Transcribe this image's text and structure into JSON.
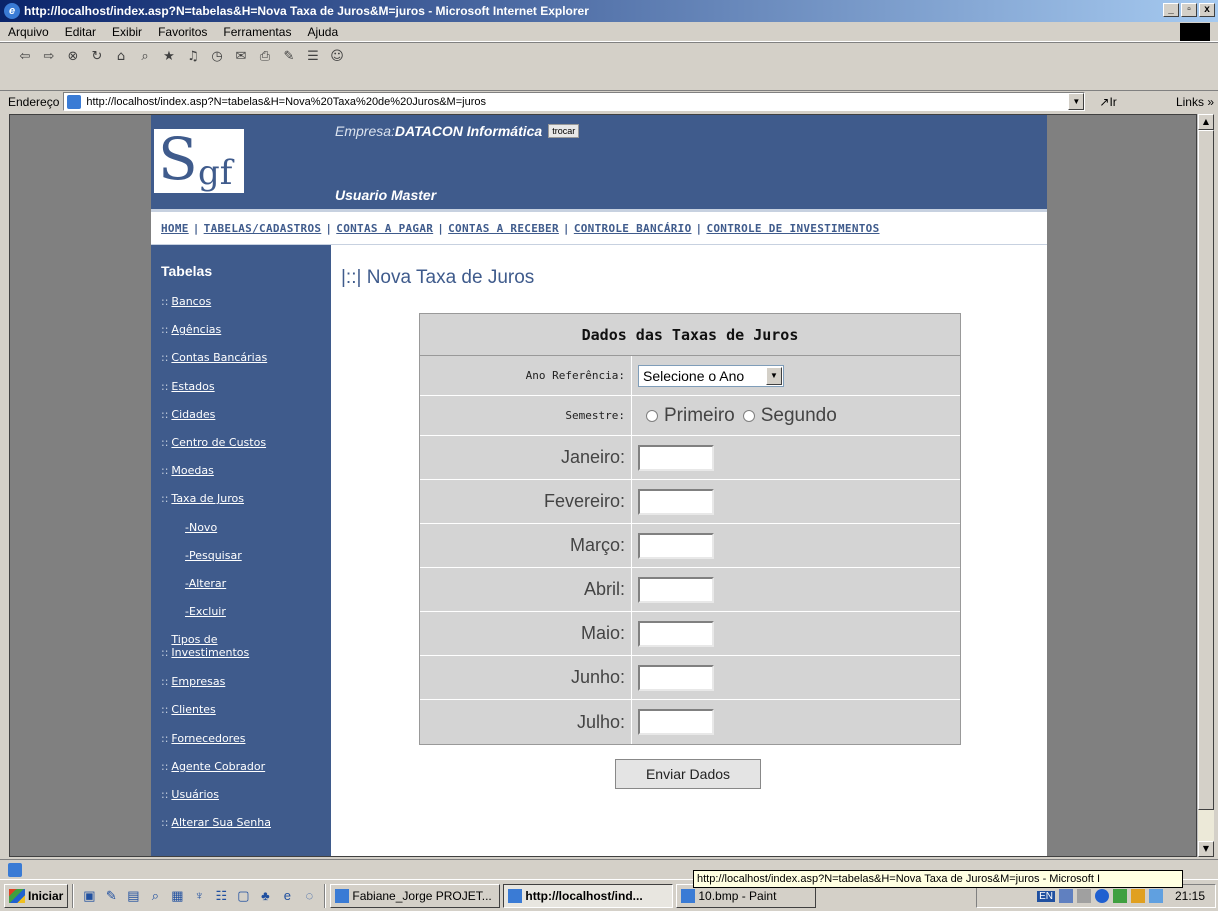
{
  "window": {
    "title": "http://localhost/index.asp?N=tabelas&H=Nova Taxa de Juros&M=juros - Microsoft Internet Explorer",
    "min": "_",
    "max": "▫",
    "close": "x"
  },
  "menu": [
    "Arquivo",
    "Editar",
    "Exibir",
    "Favoritos",
    "Ferramentas",
    "Ajuda"
  ],
  "address": {
    "label": "Endereço",
    "url": "http://localhost/index.asp?N=tabelas&H=Nova%20Taxa%20de%20Juros&M=juros",
    "go": "Ir",
    "links": "Links »"
  },
  "site": {
    "logo_s": "S",
    "logo_gf": "gf",
    "empresa_prefix": "Empresa:",
    "empresa_name": "DATACON Informática",
    "trocar": "trocar",
    "usuario": "Usuario Master",
    "nav": [
      "HOME",
      "TABELAS/CADASTROS",
      "CONTAS A PAGAR",
      "CONTAS A RECEBER",
      "CONTROLE BANCÁRIO",
      "CONTROLE DE INVESTIMENTOS"
    ],
    "nav_sep": "|"
  },
  "sidebar": {
    "title": "Tabelas",
    "prefix": "::",
    "items": [
      "Bancos",
      "Agências",
      "Contas Bancárias",
      "Estados",
      "Cidades",
      "Centro de Custos",
      "Moedas",
      "Taxa de Juros"
    ],
    "subitems": [
      "-Novo",
      "-Pesquisar",
      "-Alterar",
      "-Excluir"
    ],
    "items2": [
      "Tipos de Investimentos",
      "Empresas",
      "Clientes",
      "Fornecedores",
      "Agente Cobrador",
      "Usuários",
      "Alterar Sua Senha"
    ]
  },
  "page": {
    "title": "|::| Nova Taxa de Juros",
    "form_header": "Dados das Taxas de Juros",
    "ano_label": "Ano Referência:",
    "ano_select": "Selecione o Ano",
    "semestre_label": "Semestre:",
    "radio1": "Primeiro",
    "radio2": "Segundo",
    "months": [
      "Janeiro:",
      "Fevereiro:",
      "Março:",
      "Abril:",
      "Maio:",
      "Junho:",
      "Julho:"
    ],
    "submit": "Enviar Dados"
  },
  "status": {
    "tooltip": "http://localhost/index.asp?N=tabelas&H=Nova Taxa de Juros&M=juros - Microsoft I"
  },
  "taskbar": {
    "start": "Iniciar",
    "tasks": [
      "Fabiane_Jorge PROJET...",
      "http://localhost/ind...",
      "10.bmp - Paint"
    ],
    "tray_lang": "EN",
    "clock": "21:15"
  }
}
